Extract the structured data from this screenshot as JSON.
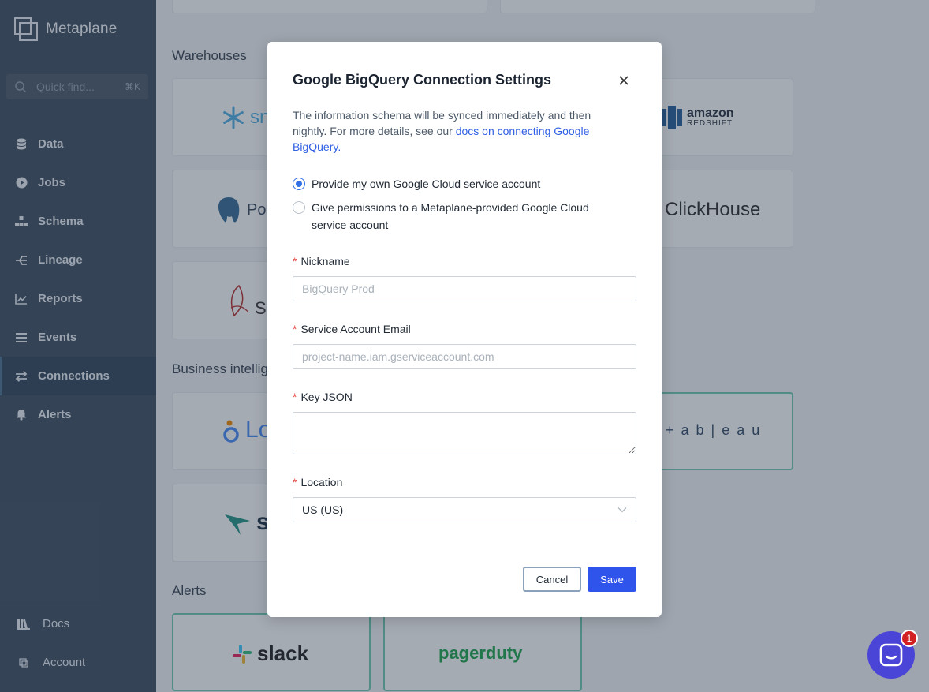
{
  "app": {
    "name": "Metaplane"
  },
  "sidebar": {
    "search": {
      "placeholder": "Quick find...",
      "shortcut": "⌘K"
    },
    "items": [
      {
        "label": "Data",
        "icon": "database-icon"
      },
      {
        "label": "Jobs",
        "icon": "play-circle-icon"
      },
      {
        "label": "Schema",
        "icon": "hierarchy-icon"
      },
      {
        "label": "Lineage",
        "icon": "lineage-icon"
      },
      {
        "label": "Reports",
        "icon": "line-chart-icon"
      },
      {
        "label": "Events",
        "icon": "list-icon"
      },
      {
        "label": "Connections",
        "icon": "swap-icon",
        "active": true
      },
      {
        "label": "Alerts",
        "icon": "bell-icon"
      }
    ],
    "bottom": [
      {
        "label": "Docs",
        "icon": "book-icon"
      },
      {
        "label": "Account",
        "icon": "account-icon"
      }
    ]
  },
  "main": {
    "sections": {
      "warehouses": "Warehouses",
      "bi": "Business intellig",
      "alerts": "Alerts"
    },
    "logos": {
      "snowflake": "sno",
      "amazon": "amazon",
      "redshift": "REDSHIFT",
      "postgres": "Pos",
      "clickhouse": "ClickHouse",
      "sqlserver": "SQ",
      "looker": "Lo",
      "tableau": "+ a b | e a u",
      "sigma": "si",
      "slack": "slack",
      "pagerduty": "pagerduty"
    }
  },
  "modal": {
    "title": "Google BigQuery Connection Settings",
    "description_prefix": "The information schema will be synced immediately and then nightly. For more details, see our ",
    "description_link": "docs on connecting Google BigQuery.",
    "options": [
      {
        "label": "Provide my own Google Cloud service account",
        "checked": true
      },
      {
        "label": "Give permissions to a Metaplane-provided Google Cloud service account",
        "checked": false
      }
    ],
    "fields": {
      "nickname": {
        "label": "Nickname",
        "placeholder": "BigQuery Prod"
      },
      "email": {
        "label": "Service Account Email",
        "placeholder": "project-name.iam.gserviceaccount.com"
      },
      "key_json": {
        "label": "Key JSON"
      },
      "location": {
        "label": "Location",
        "value": "US (US)"
      }
    },
    "buttons": {
      "cancel": "Cancel",
      "save": "Save"
    }
  },
  "chat": {
    "badge": "1"
  },
  "colors": {
    "sidebar_bg": "#3a4a5e",
    "primary": "#2f54eb",
    "link": "#2f5fe3",
    "required": "#e2483d",
    "chat": "#4a45d6"
  }
}
